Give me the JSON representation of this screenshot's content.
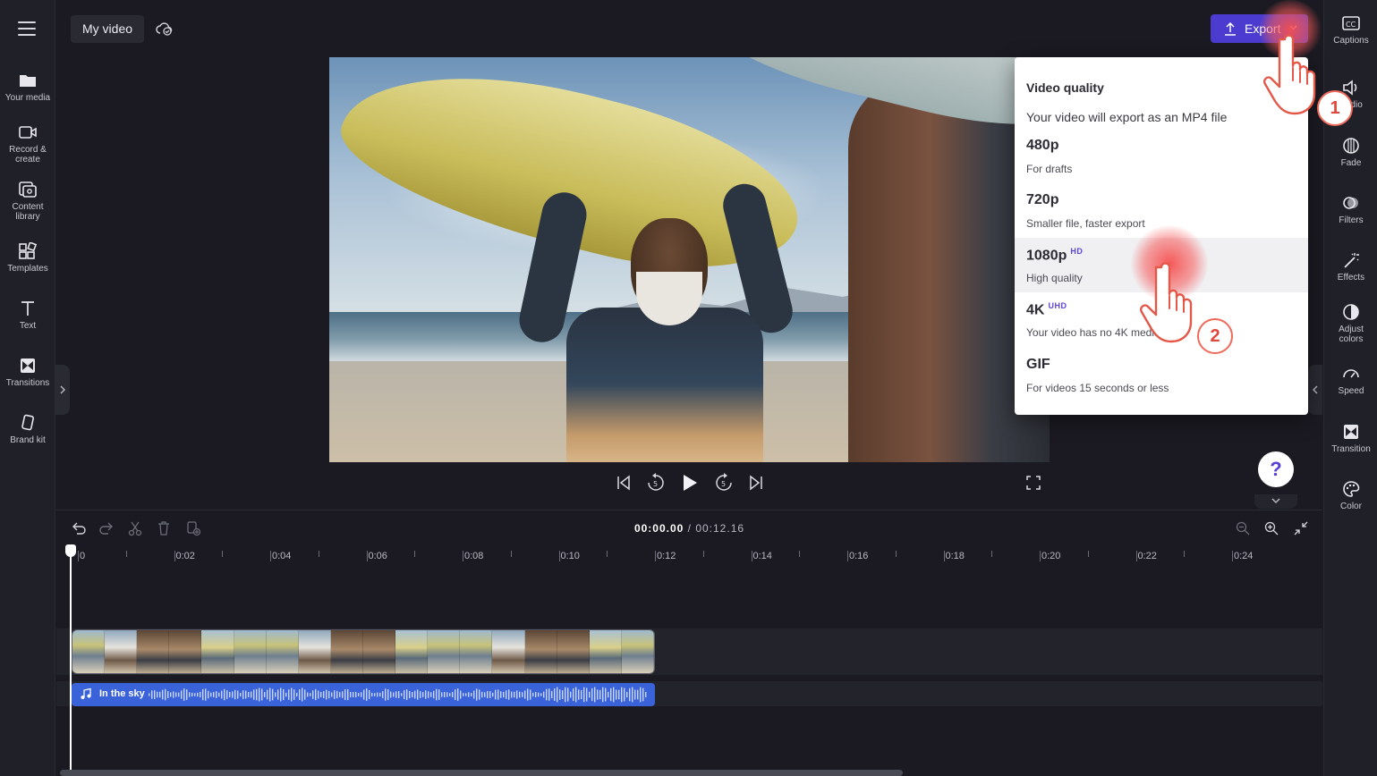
{
  "header": {
    "project_title": "My video",
    "export_label": "Export"
  },
  "left_rail": {
    "items": [
      {
        "label": "Your media"
      },
      {
        "label": "Record &\ncreate"
      },
      {
        "label": "Content\nlibrary"
      },
      {
        "label": "Templates"
      },
      {
        "label": "Text"
      },
      {
        "label": "Transitions"
      },
      {
        "label": "Brand kit"
      }
    ]
  },
  "right_rail": {
    "items": [
      {
        "label": "Captions"
      },
      {
        "label": "Audio"
      },
      {
        "label": "Fade"
      },
      {
        "label": "Filters"
      },
      {
        "label": "Effects"
      },
      {
        "label": "Adjust\ncolors"
      },
      {
        "label": "Speed"
      },
      {
        "label": "Transition"
      },
      {
        "label": "Color"
      }
    ]
  },
  "export_menu": {
    "heading": "Video quality",
    "subtitle": "Your video will export as an MP4 file",
    "options": [
      {
        "label": "480p",
        "badge": "",
        "description": "For drafts"
      },
      {
        "label": "720p",
        "badge": "",
        "description": "Smaller file, faster export"
      },
      {
        "label": "1080p",
        "badge": "HD",
        "description": "High quality"
      },
      {
        "label": "4K",
        "badge": "UHD",
        "description": "Your video has no 4K media"
      },
      {
        "label": "GIF",
        "badge": "",
        "description": "For videos 15 seconds or less"
      }
    ]
  },
  "help_label": "?",
  "timeline": {
    "current_time": "00:00.00",
    "separator": " / ",
    "total_time": "00:12.16",
    "ticks": [
      "0",
      "0:02",
      "0:04",
      "0:06",
      "0:08",
      "0:10",
      "0:12",
      "0:14",
      "0:16",
      "0:18",
      "0:20",
      "0:22",
      "0:24"
    ],
    "audio_clip_name": "In the sky"
  },
  "steps": [
    "1",
    "2"
  ],
  "colors": {
    "accent": "#4b3ccf",
    "audio_clip": "#3b63d9",
    "badge": "#5b45d4",
    "click_highlight": "#f65050"
  }
}
